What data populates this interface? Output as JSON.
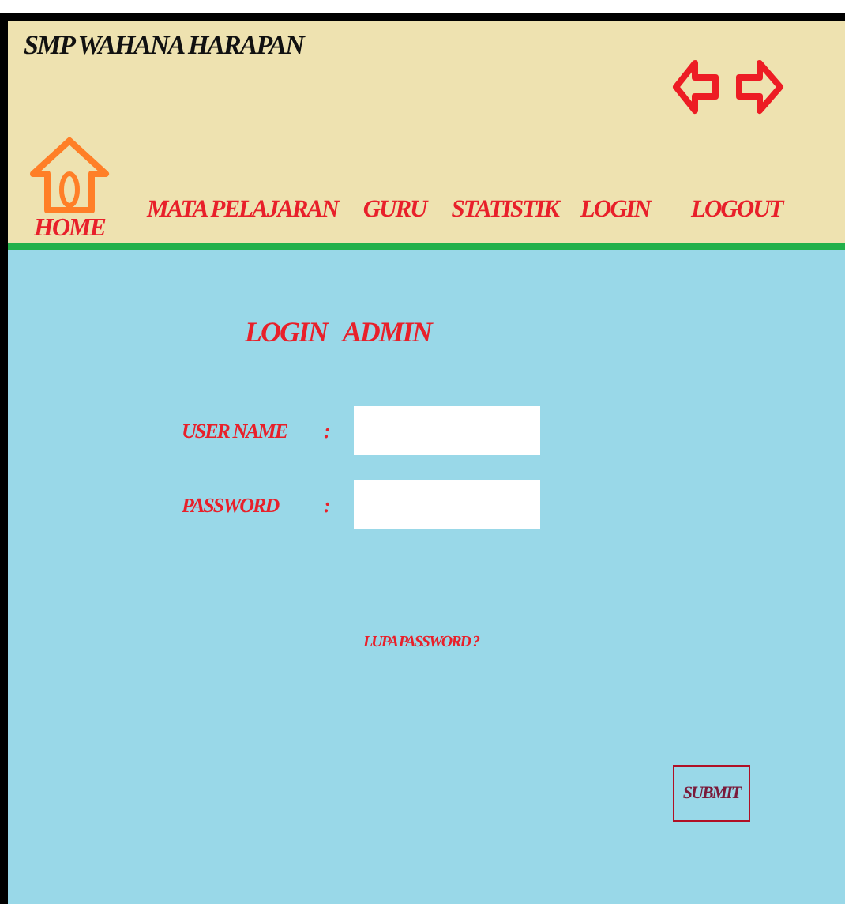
{
  "header": {
    "title": "SMP WAHANA HARAPAN"
  },
  "nav": [
    {
      "label": "HOME",
      "kind": "home"
    },
    {
      "label": "MATA PELAJARAN",
      "kind": "link"
    },
    {
      "label": "GURU",
      "kind": "link"
    },
    {
      "label": "STATISTIK",
      "kind": "link"
    },
    {
      "label": "LOGIN",
      "kind": "link"
    },
    {
      "label": "LOGOUT",
      "kind": "link"
    }
  ],
  "login": {
    "heading": "LOGIN   ADMIN",
    "fields": [
      {
        "label": "USER NAME",
        "separator": ":"
      },
      {
        "label": "PASSWORD",
        "separator": ":"
      }
    ],
    "forgot_link": "LUPA PASSWORD ?",
    "submit": "SUBMIT"
  }
}
